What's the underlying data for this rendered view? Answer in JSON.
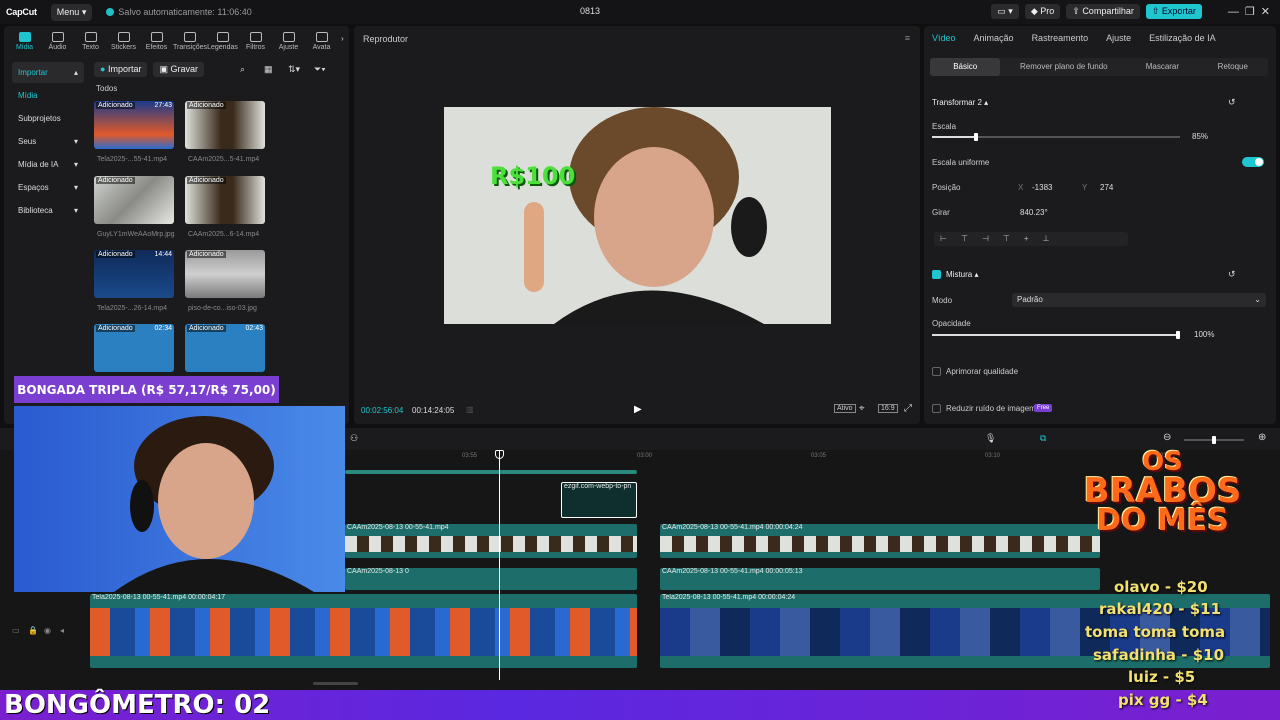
{
  "titlebar": {
    "logo": "CapCut",
    "menu": "Menu",
    "autosave": "Salvo automaticamente: 11:06:40",
    "project": "0813",
    "pro": "Pro",
    "share": "Compartilhar",
    "export": "Exportar"
  },
  "tools": [
    {
      "label": "Mídia"
    },
    {
      "label": "Áudio"
    },
    {
      "label": "Texto"
    },
    {
      "label": "Stickers"
    },
    {
      "label": "Efeitos"
    },
    {
      "label": "Transições"
    },
    {
      "label": "Legendas"
    },
    {
      "label": "Filtros"
    },
    {
      "label": "Ajuste"
    },
    {
      "label": "Avata"
    }
  ],
  "sidenav": {
    "import": "Importar",
    "media": "Mídia",
    "subprojects": "Subprojetos",
    "yours": "Seus",
    "ai_media": "Mídia de IA",
    "spaces": "Espaços",
    "library": "Biblioteca"
  },
  "media": {
    "import_btn": "Importar",
    "record_btn": "Gravar",
    "all": "Todos",
    "items": [
      {
        "tag": "Adicionado",
        "duration": "27:43",
        "name": "Tela2025-...55-41.mp4"
      },
      {
        "tag": "Adicionado",
        "duration": "",
        "name": "CAAm2025...5-41.mp4"
      },
      {
        "tag": "Adicionado",
        "duration": "",
        "name": "GuyLY1mWeAAoMrp.jpg"
      },
      {
        "tag": "Adicionado",
        "duration": "",
        "name": "CAAm2025...6-14.mp4"
      },
      {
        "tag": "Adicionado",
        "duration": "14:44",
        "name": "Tela2025-...26-14.mp4"
      },
      {
        "tag": "Adicionado",
        "duration": "",
        "name": "piso-de-co...iso-03.jpg"
      },
      {
        "tag": "Adicionado",
        "duration": "02:34",
        "name": ""
      },
      {
        "tag": "Adicionado",
        "duration": "02:43",
        "name": ""
      }
    ]
  },
  "player": {
    "title": "Reprodutor",
    "overlay_text": "R$100",
    "current_time": "00:02:56:04",
    "total_time": "00:14:24:05",
    "ratio": "16:9",
    "full": "Ativo"
  },
  "inspector": {
    "tabs": [
      "Vídeo",
      "Animação",
      "Rastreamento",
      "Ajuste",
      "Estilização de IA"
    ],
    "subtabs": [
      "Básico",
      "Remover plano de fundo",
      "Mascarar",
      "Retoque"
    ],
    "transform": "Transformar 2",
    "scale_label": "Escala",
    "scale_value": "85%",
    "scale_fraction": 0.85,
    "uniform_scale": "Escala uniforme",
    "position_label": "Posição",
    "x_label": "X",
    "x_value": "-1383",
    "y_label": "Y",
    "y_value": "274",
    "rotate_label": "Girar",
    "rotate_value": "840.23°",
    "blend_label": "Mistura",
    "mode_label": "Modo",
    "mode_value": "Padrão",
    "opacity_label": "Opacidade",
    "opacity_value": "100%",
    "improve_quality": "Aprimorar qualidade",
    "reduce_noise": "Reduzir ruído de imagem",
    "free_badge": "Free"
  },
  "timeline": {
    "ticks": [
      "03:55",
      "03:00",
      "03:05",
      "03:10",
      "03:15"
    ],
    "overlay_clip": "ezgif.com-webp-to-pn",
    "clips_a": [
      "-55-41.mp4",
      "CAAm2025-08-13 00-55-41.mp4",
      "CAAm2025-08-13 0",
      "CAAm2025-08-13 00-55-41.mp4  00:00:04:24",
      "CAAm2025-08-13 00-55-41.mp4  00:00:05:13",
      "CAAm2025-08-1"
    ],
    "clips_b": [
      "Tela2025-08-13 00-55-41.mp4  00:00:04:17",
      "Tela2025-08-13 00-55-41.mp4",
      "Tela2025-08-13 00-55-41.mp4",
      "Tela202",
      "Tela2025-08-13 00-55-41.mp4  00:00:04:24",
      "Tela2025-08-13 00-55-41.mp4  00:00:05:13",
      "Tela2025-08-13 00"
    ]
  },
  "stream": {
    "banner": "BONGADA TRIPLA (R$ 57,17/R$ 75,00)",
    "bongometro": "BONGÔMETRO: 02",
    "brabos_line1": "OS",
    "brabos_line2": "BRABOS",
    "brabos_line3": "DO MÊS",
    "donors": [
      "olavo - $20",
      "rakal420 - $11",
      "toma toma toma",
      "safadinha - $10",
      "luiz - $5",
      "pix gg - $4"
    ]
  },
  "colors": {
    "accent": "#1fc5cf",
    "clip_teal": "#1d6e6a",
    "purple": "#7a3fd0"
  }
}
